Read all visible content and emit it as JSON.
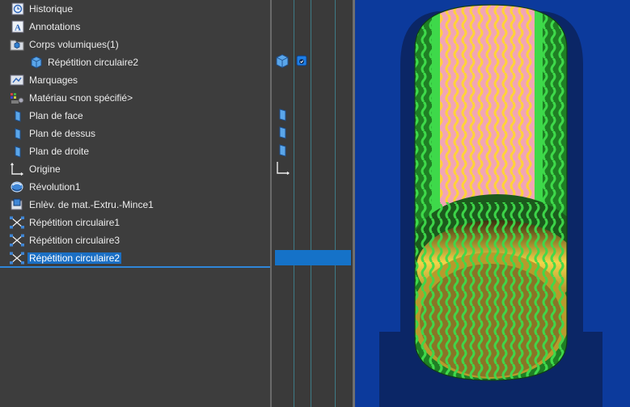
{
  "tree": {
    "items": [
      {
        "label": "Historique",
        "icon": "history-icon"
      },
      {
        "label": "Annotations",
        "icon": "annotations-icon"
      },
      {
        "label": "Corps volumiques(1)",
        "icon": "solid-bodies-folder-icon"
      },
      {
        "label": "Répétition circulaire2",
        "icon": "solid-body-icon"
      },
      {
        "label": "Marquages",
        "icon": "markups-icon"
      },
      {
        "label": "Matériau <non spécifié>",
        "icon": "material-icon"
      },
      {
        "label": "Plan de face",
        "icon": "plane-icon"
      },
      {
        "label": "Plan de dessus",
        "icon": "plane-icon"
      },
      {
        "label": "Plan de droite",
        "icon": "plane-icon"
      },
      {
        "label": "Origine",
        "icon": "origin-icon"
      },
      {
        "label": "Révolution1",
        "icon": "revolve-icon"
      },
      {
        "label": "Enlèv. de mat.-Extru.-Mince1",
        "icon": "extruded-cut-icon"
      },
      {
        "label": "Répétition circulaire1",
        "icon": "circular-pattern-icon"
      },
      {
        "label": "Répétition circulaire3",
        "icon": "circular-pattern-icon"
      },
      {
        "label": "Répétition circulaire2",
        "icon": "circular-pattern-icon",
        "selected": true
      }
    ]
  },
  "colors": {
    "panel_bg": "#3d3d3d",
    "selection": "#1b6fc4",
    "viewport_bg": "#0c3a9c",
    "mesh_green": "#3ed94a",
    "pink_band": "#f0a0b0",
    "inner_gold": "#d9b63a"
  }
}
